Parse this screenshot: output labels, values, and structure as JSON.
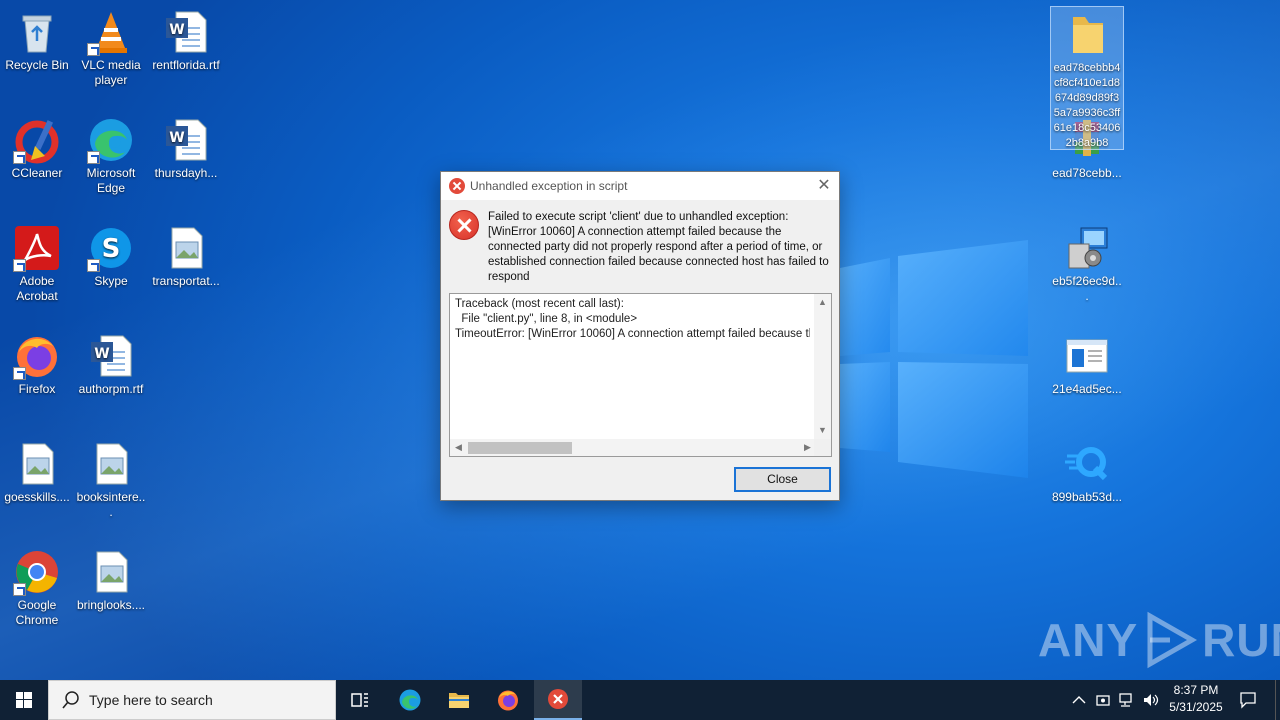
{
  "desktop": {
    "icons": [
      {
        "label": "Recycle Bin",
        "icon": "recycle-bin-icon"
      },
      {
        "label": "VLC media player",
        "icon": "vlc-icon"
      },
      {
        "label": "rentflorida.rtf",
        "icon": "word-doc-icon"
      },
      {
        "label": "CCleaner",
        "icon": "ccleaner-icon"
      },
      {
        "label": "Microsoft Edge",
        "icon": "edge-icon"
      },
      {
        "label": "thursdayh...",
        "icon": "word-doc-icon"
      },
      {
        "label": "Adobe Acrobat",
        "icon": "acrobat-icon"
      },
      {
        "label": "Skype",
        "icon": "skype-icon"
      },
      {
        "label": "transportat...",
        "icon": "image-file-icon"
      },
      {
        "label": "Firefox",
        "icon": "firefox-icon"
      },
      {
        "label": "authorpm.rtf",
        "icon": "word-doc-icon"
      },
      {
        "label": "goesskills....",
        "icon": "image-file-icon"
      },
      {
        "label": "booksintere...",
        "icon": "image-file-icon"
      },
      {
        "label": "Google Chrome",
        "icon": "chrome-icon"
      },
      {
        "label": "bringlooks....",
        "icon": "image-file-icon"
      },
      {
        "label": "ead78cebbb4cf8cf410e1d8674d89d89f35a7a9936c3ff61e18c534062b8a9b8",
        "icon": "folder-icon"
      },
      {
        "label": "ead78cebb...",
        "icon": "winrar-icon"
      },
      {
        "label": "eb5f26ec9d...",
        "icon": "installer-icon"
      },
      {
        "label": "21e4ad5ec...",
        "icon": "window-app-icon"
      },
      {
        "label": "899bab53d...",
        "icon": "q-app-icon"
      }
    ]
  },
  "dialog": {
    "title": "Unhandled exception in script",
    "message": "Failed to execute script 'client' due to unhandled exception: [WinError 10060] A connection attempt failed because the connected party did not properly respond after a period of time, or established connection failed because connected host has failed to respond",
    "traceback": "Traceback (most recent call last):\n  File \"client.py\", line 8, in <module>\nTimeoutError: [WinError 10060] A connection attempt failed because the connected party did not properly respond after a period of time, or established connection failed because connected host has failed to respond",
    "close_label": "Close",
    "close_x": "✕"
  },
  "watermark": {
    "left": "ANY",
    "right": "RUN"
  },
  "taskbar": {
    "search_placeholder": "Type here to search",
    "time": "8:37 PM",
    "date": "5/31/2025",
    "apps": [
      "task-view-icon",
      "edge-icon",
      "file-explorer-icon",
      "firefox-icon",
      "error-app-icon"
    ]
  },
  "colors": {
    "accent": "#1a73d6",
    "error": "#e24a3a",
    "taskbar": "#102135"
  }
}
